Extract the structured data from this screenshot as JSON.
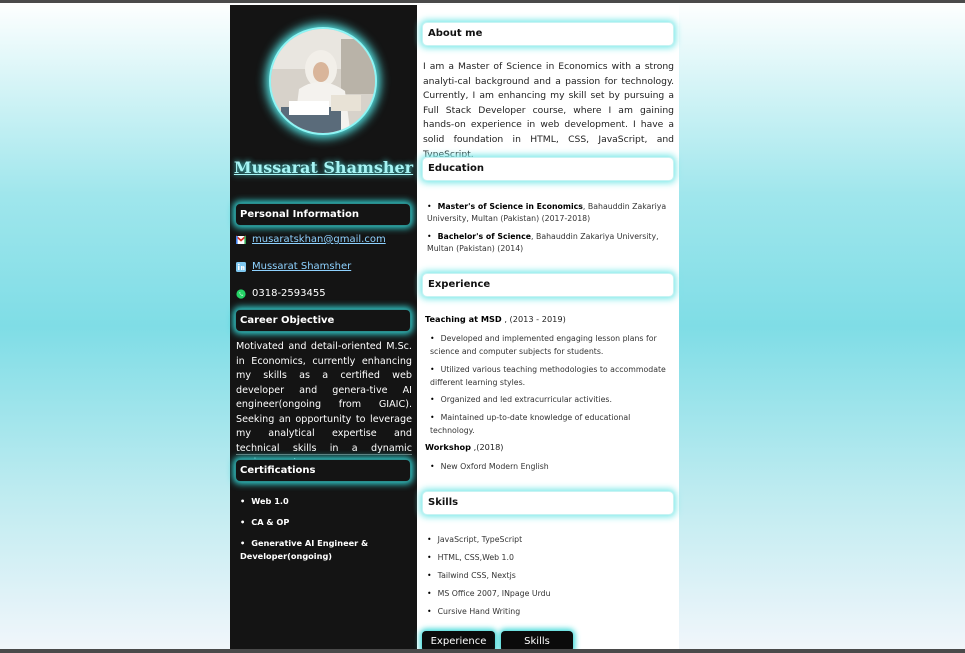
{
  "profile": {
    "name": "Mussarat Shamsher",
    "avatar_icon": "profile-photo"
  },
  "personal": {
    "heading": "Personal Information",
    "email": "musaratskhan@gmail.com",
    "linkedin": "Mussarat Shamsher",
    "phone": "0318-2593455",
    "icons": [
      "gmail-icon",
      "linkedin-icon",
      "whatsapp-icon"
    ]
  },
  "objective": {
    "heading": "Career Objective",
    "text": "Motivated and detail-oriented M.Sc. in Economics, currently enhancing my skills as a certified web developer and genera-tive AI engineer(ongoing from GIAIC). Seeking an opportunity to leverage my analytical expertise and technical skills in a dynamic environment."
  },
  "certifications": {
    "heading": "Certifications",
    "items": [
      "Web 1.0",
      "CA & OP",
      "Generative AI Engineer & Developer(ongoing)"
    ]
  },
  "about": {
    "heading": "About me",
    "text": "I am a Master of Science in Economics with a strong analyti-cal background and a passion for technology. Currently, I am enhancing my skill set by pursuing a Full Stack Developer course, where I am gaining hands-on experience in web development. I have a solid foundation in HTML, CSS, JavaScript, and TypeScript."
  },
  "education": {
    "heading": "Education",
    "items": [
      {
        "degree": "Master's of Science in Economics",
        "detail": ", Bahauddin Zakariya University, Multan (Pakistan) (2017-2018)"
      },
      {
        "degree": "Bachelor's of Science",
        "detail": ", Bahauddin Zakariya University, Multan (Pakistan) (2014)"
      }
    ]
  },
  "experience": {
    "heading": "Experience",
    "job1_title": "Teaching at MSD",
    "job1_years": " , (2013 - 2019)",
    "job1_items": [
      "Developed and implemented engaging lesson plans for science and computer subjects for students.",
      "Utilized various teaching methodologies to accommodate different learning styles.",
      "Organized and led extracurricular activities.",
      "Maintained up-to-date knowledge of educational technology."
    ],
    "job2_title": "Workshop",
    "job2_years": " ,(2018)",
    "job2_items": [
      "New Oxford Modern English"
    ]
  },
  "skills": {
    "heading": "Skills",
    "items": [
      "JavaScript, TypeScript",
      "HTML, CSS,Web 1.0",
      "Tailwind CSS, Nextjs",
      "MS Office 2007, INpage Urdu",
      "Cursive Hand Writing"
    ]
  },
  "buttons": {
    "experience": "Experience",
    "skills": "Skills"
  }
}
